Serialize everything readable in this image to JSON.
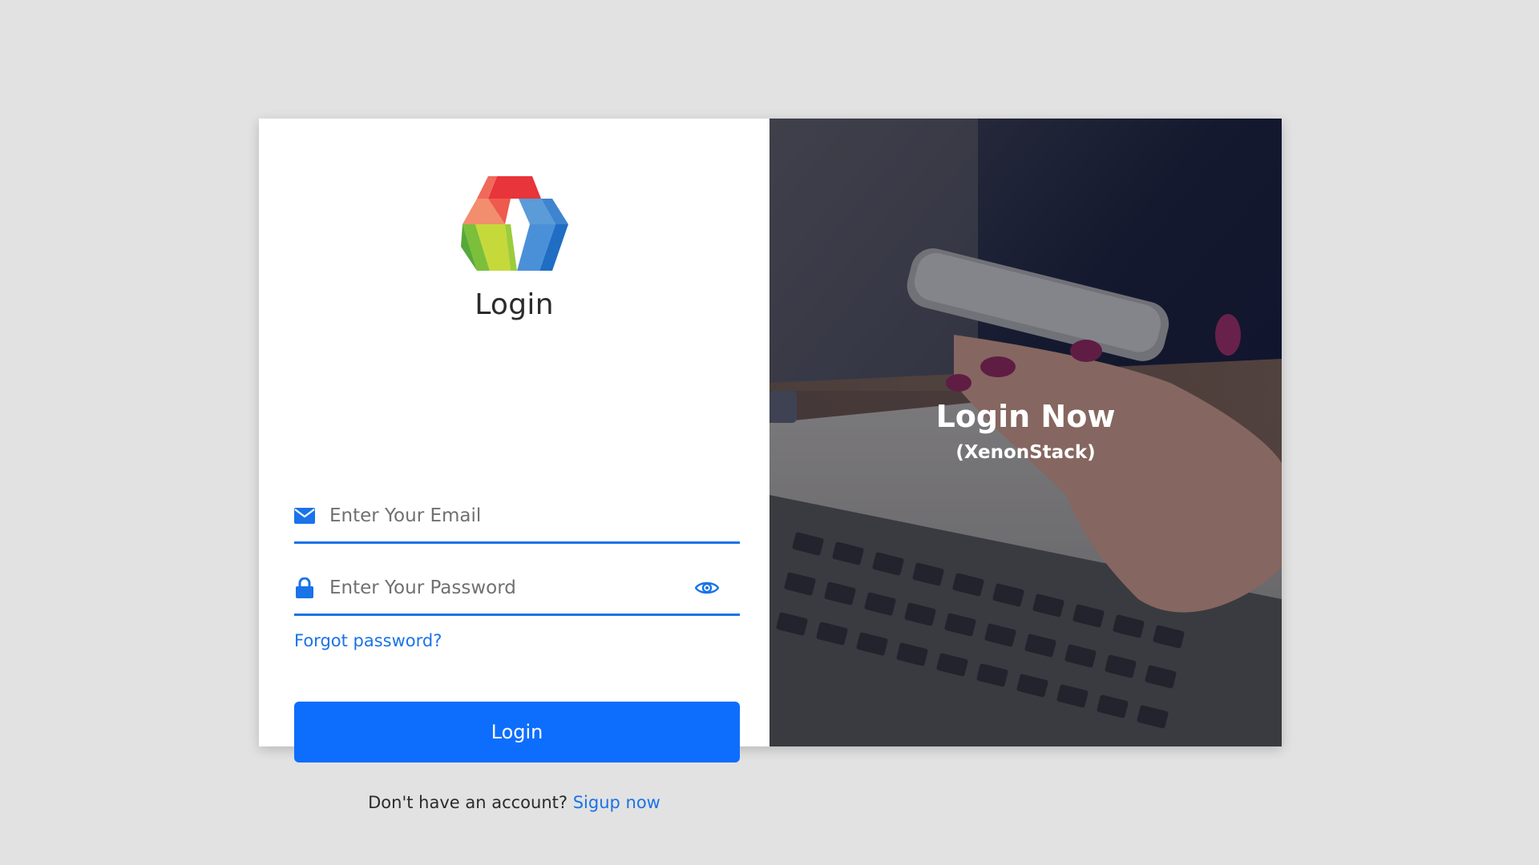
{
  "login_form": {
    "title": "Login",
    "email": {
      "placeholder": "Enter Your Email",
      "value": "",
      "icon": "envelope-icon"
    },
    "password": {
      "placeholder": "Enter Your Password",
      "value": "",
      "icon": "lock-icon",
      "toggle_icon": "eye-icon"
    },
    "forgot_label": "Forgot password?",
    "submit_label": "Login",
    "signup_prompt": "Don't have an account?",
    "signup_link": "Sigup now"
  },
  "hero": {
    "title": "Login Now",
    "subtitle": "(XenonStack)"
  },
  "colors": {
    "accent": "#0d6efd",
    "link": "#1a73e8",
    "background": "#e2e2e2"
  }
}
